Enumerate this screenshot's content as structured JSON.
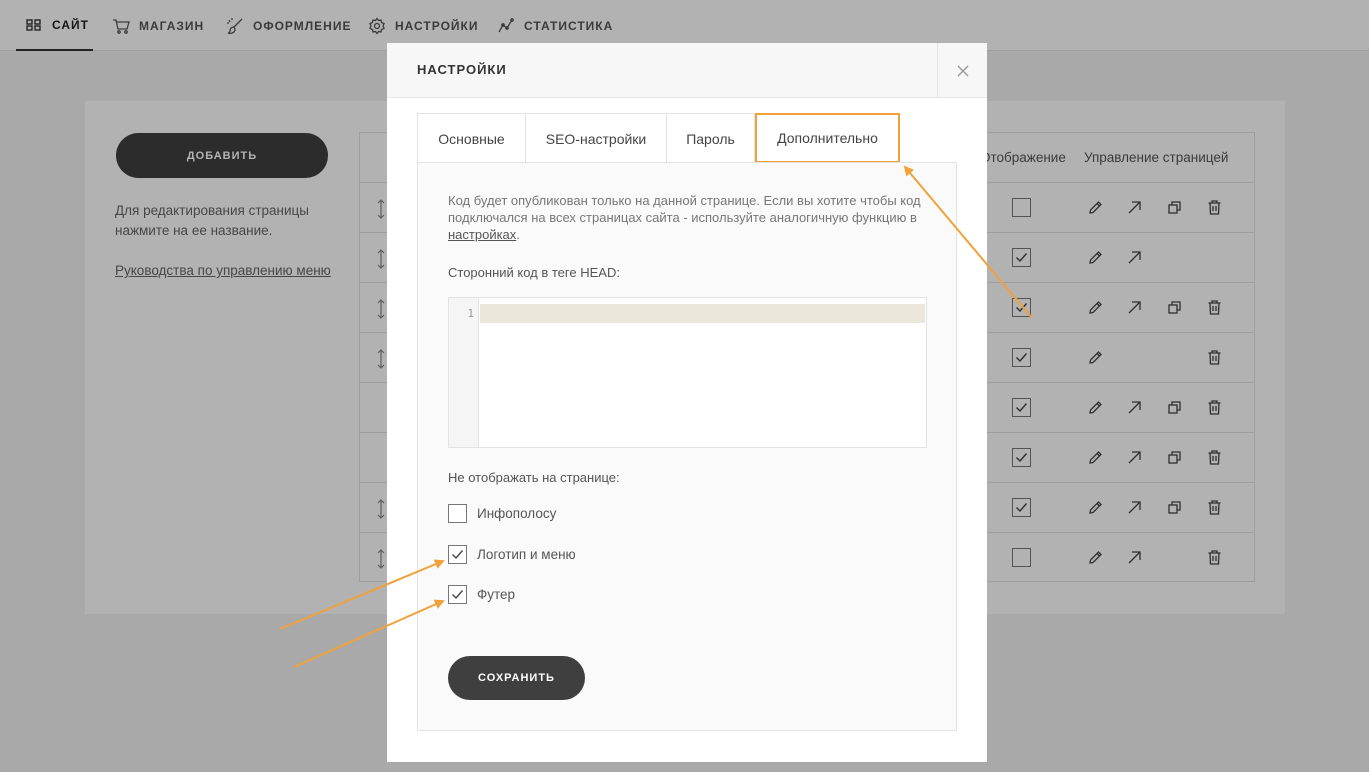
{
  "nav": {
    "items": [
      {
        "label": "САЙТ",
        "icon": "grid-icon",
        "active": true
      },
      {
        "label": "МАГАЗИН",
        "icon": "cart-icon",
        "active": false
      },
      {
        "label": "ОФОРМЛЕНИЕ",
        "icon": "brush-icon",
        "active": false
      },
      {
        "label": "НАСТРОЙКИ",
        "icon": "gear-icon",
        "active": false
      },
      {
        "label": "СТАТИСТИКА",
        "icon": "chart-line-icon",
        "active": false
      }
    ]
  },
  "sidebar": {
    "add_label": "ДОБАВИТЬ",
    "hint": "Для редактирования страницы нажмите на ее название.",
    "guide_link": "Руководства по управлению меню"
  },
  "table": {
    "col_display": "Отображение",
    "col_manage": "Управление страницей",
    "rows": [
      {
        "drag": true,
        "visible": false,
        "edit": true,
        "open": true,
        "copy": true,
        "delete": true
      },
      {
        "drag": true,
        "visible": true,
        "edit": true,
        "open": true,
        "copy": false,
        "delete": false
      },
      {
        "drag": true,
        "visible": true,
        "edit": true,
        "open": true,
        "copy": true,
        "delete": true
      },
      {
        "drag": true,
        "visible": true,
        "edit": true,
        "open": false,
        "copy": false,
        "delete": true
      },
      {
        "drag": false,
        "visible": true,
        "edit": true,
        "open": true,
        "copy": true,
        "delete": true
      },
      {
        "drag": false,
        "visible": true,
        "edit": true,
        "open": true,
        "copy": true,
        "delete": true
      },
      {
        "drag": true,
        "visible": true,
        "edit": true,
        "open": true,
        "copy": true,
        "delete": true
      },
      {
        "drag": true,
        "visible": false,
        "edit": true,
        "open": true,
        "copy": false,
        "delete": true
      }
    ]
  },
  "modal": {
    "title": "НАСТРОЙКИ",
    "tabs": [
      {
        "label": "Основные",
        "active": false
      },
      {
        "label": "SEO-настройки",
        "active": false
      },
      {
        "label": "Пароль",
        "active": false
      },
      {
        "label": "Дополнительно",
        "active": true
      }
    ],
    "info_text": "Код будет опубликован только на данной странице. Если вы хотите чтобы код подключался на всех страницах сайта - используйте аналогичную функцию в",
    "info_link": "настройках",
    "info_tail": ".",
    "head_code_label": "Сторонний код в теге HEAD:",
    "code_line_number": "1",
    "code_value": "",
    "hide_label": "Не отображать на странице:",
    "options": [
      {
        "label": "Инфополосу",
        "checked": false
      },
      {
        "label": "Логотип и меню",
        "checked": true
      },
      {
        "label": "Футер",
        "checked": true
      }
    ],
    "save_label": "СОХРАНИТЬ"
  },
  "colors": {
    "annotation": "#f0a13a",
    "button": "#3f3f3f"
  }
}
